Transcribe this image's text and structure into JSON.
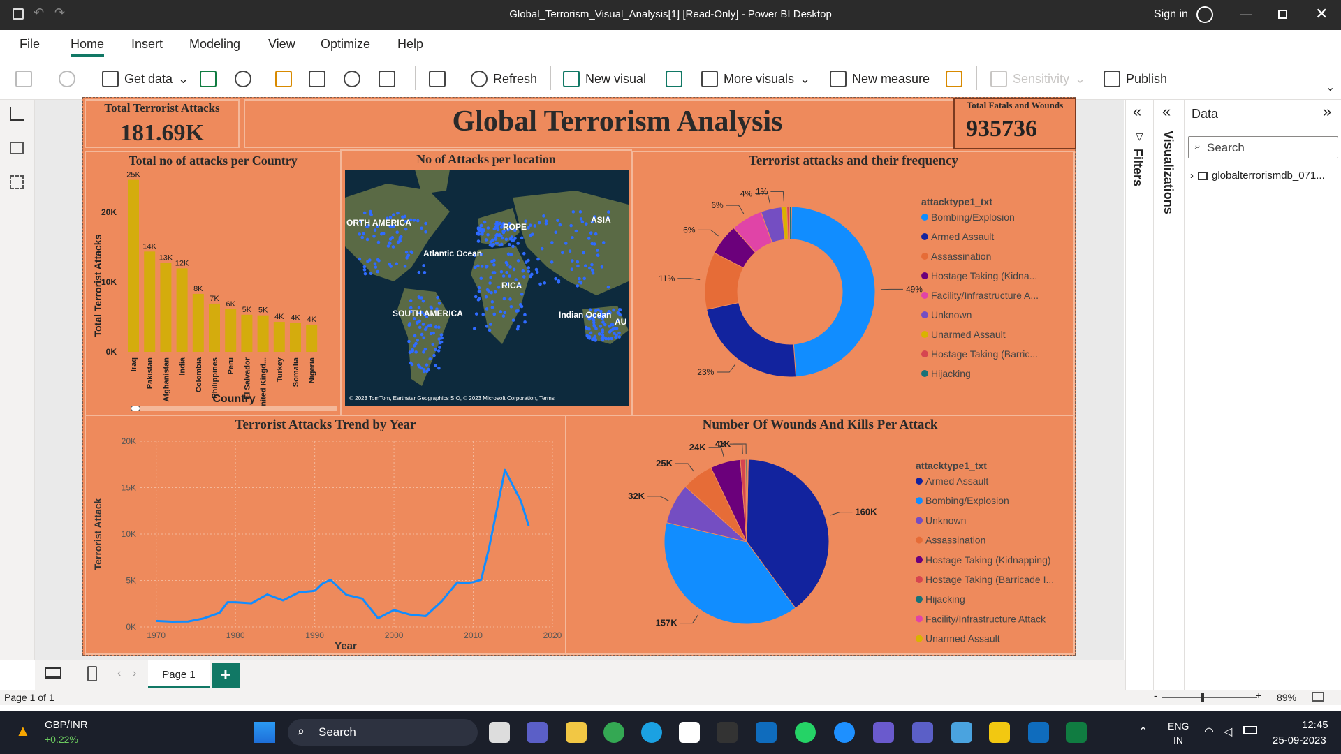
{
  "window": {
    "title": "Global_Terrorism_Visual_Analysis[1] [Read-Only] - Power BI Desktop",
    "sign_in": "Sign in"
  },
  "menu": [
    "File",
    "Home",
    "Insert",
    "Modeling",
    "View",
    "Optimize",
    "Help"
  ],
  "ribbon": {
    "get_data": "Get data",
    "refresh": "Refresh",
    "new_visual": "New visual",
    "more_visuals": "More visuals",
    "new_measure": "New measure",
    "sensitivity": "Sensitivity",
    "publish": "Publish"
  },
  "report": {
    "title": "Global Terrorism Analysis",
    "kpi1": {
      "label": "Total Terrorist Attacks",
      "value": "181.69K"
    },
    "kpi2": {
      "label": "Total Fatals and Wounds",
      "value": "935736"
    },
    "map": {
      "title": "No of Attacks per location",
      "labels": [
        "ORTH AMERICA",
        "Atlantic Ocean",
        "SOUTH AMERICA",
        "ASIA",
        "ROPE",
        "RICA",
        "Indian Ocean",
        "AU"
      ],
      "credit": "© 2023 TomTom, Earthstar Geographics SIO, © 2023 Microsoft Corporation, Terms"
    },
    "donut_legend_title": "attacktype1_txt",
    "pie_legend_title": "attacktype1_txt"
  },
  "chart_data": [
    {
      "type": "bar",
      "title": "Total no of attacks per Country",
      "xlabel": "Country",
      "ylabel": "Total Terrorist Attacks",
      "categories": [
        "Iraq",
        "Pakistan",
        "Afghanistan",
        "India",
        "Colombia",
        "Philippines",
        "Peru",
        "El Salvador",
        "United Kingd...",
        "Turkey",
        "Somalia",
        "Nigeria"
      ],
      "values": [
        24636,
        14368,
        12731,
        11960,
        8306,
        6908,
        6096,
        5320,
        5235,
        4292,
        4142,
        3907
      ],
      "data_labels": [
        "25K",
        "14K",
        "13K",
        "12K",
        "8K",
        "7K",
        "6K",
        "5K",
        "5K",
        "4K",
        "4K",
        "4K"
      ],
      "yticks": [
        "0K",
        "10K",
        "20K"
      ],
      "ylim": [
        0,
        25000
      ],
      "color": "#d4ac0d"
    },
    {
      "type": "pie",
      "title": "Terrorist attacks and their frequency",
      "donut": true,
      "categories": [
        "Bombing/Explosion",
        "Armed Assault",
        "Assassination",
        "Hostage Taking (Kidna...",
        "Facility/Infrastructure A...",
        "Unknown",
        "Unarmed Assault",
        "Hostage Taking (Barric...",
        "Hijacking"
      ],
      "values": [
        49,
        23,
        11,
        6,
        6,
        4,
        1,
        0.5,
        0.4
      ],
      "data_labels": [
        "49%",
        "23%",
        "11%",
        "6%",
        "6%",
        "4%",
        "1%",
        "",
        ""
      ],
      "colors": [
        "#118dff",
        "#12239e",
        "#e66c37",
        "#6b007b",
        "#e044a7",
        "#744ec2",
        "#d9b300",
        "#d64550",
        "#197278"
      ]
    },
    {
      "type": "line",
      "title": "Terrorist Attacks Trend by Year",
      "xlabel": "Year",
      "ylabel": "Terrorist Attack",
      "xticks": [
        "1970",
        "1980",
        "1990",
        "2000",
        "2010",
        "2020"
      ],
      "yticks": [
        "0K",
        "5K",
        "10K",
        "15K",
        "20K"
      ],
      "xlim": [
        1968,
        2020
      ],
      "ylim": [
        0,
        20000
      ],
      "x": [
        1970,
        1972,
        1974,
        1976,
        1978,
        1979,
        1980,
        1982,
        1984,
        1986,
        1988,
        1990,
        1991,
        1992,
        1994,
        1996,
        1998,
        1999,
        2000,
        2002,
        2004,
        2006,
        2008,
        2009,
        2010,
        2011,
        2012,
        2014,
        2016,
        2017
      ],
      "y": [
        651,
        568,
        581,
        923,
        1526,
        2662,
        2662,
        2544,
        3495,
        2860,
        3721,
        3887,
        4683,
        5071,
        3456,
        3058,
        934,
        1395,
        1814,
        1333,
        1166,
        2758,
        4805,
        4721,
        4826,
        5076,
        8522,
        16903,
        13587,
        10900
      ],
      "color": "#118dff"
    },
    {
      "type": "pie",
      "title": "Number Of Wounds And Kills Per Attack",
      "categories": [
        "Armed Assault",
        "Bombing/Explosion",
        "Unknown",
        "Assassination",
        "Hostage Taking (Kidnapping)",
        "Hostage Taking (Barricade I...",
        "Hijacking",
        "Facility/Infrastructure Attack",
        "Unarmed Assault"
      ],
      "values": [
        160000,
        157000,
        32000,
        25000,
        24000,
        4000,
        1000,
        700,
        500
      ],
      "data_labels": [
        "160K",
        "157K",
        "32K",
        "25K",
        "24K",
        "4K",
        "1K",
        "",
        ""
      ],
      "colors": [
        "#12239e",
        "#118dff",
        "#744ec2",
        "#e66c37",
        "#6b007b",
        "#d64550",
        "#197278",
        "#e044a7",
        "#d9b300"
      ]
    }
  ],
  "right": {
    "filters": "Filters",
    "visualizations": "Visualizations",
    "data_title": "Data",
    "search_placeholder": "Search",
    "table": "globalterrorismdb_071..."
  },
  "pages": {
    "page1": "Page 1",
    "add": "+"
  },
  "status": {
    "page": "Page 1 of 1",
    "zoom": "89%"
  },
  "taskbar": {
    "ticker": "GBP/INR",
    "change": "+0.22%",
    "search": "Search",
    "lang1": "ENG",
    "lang2": "IN",
    "time": "12:45",
    "date": "25-09-2023"
  }
}
